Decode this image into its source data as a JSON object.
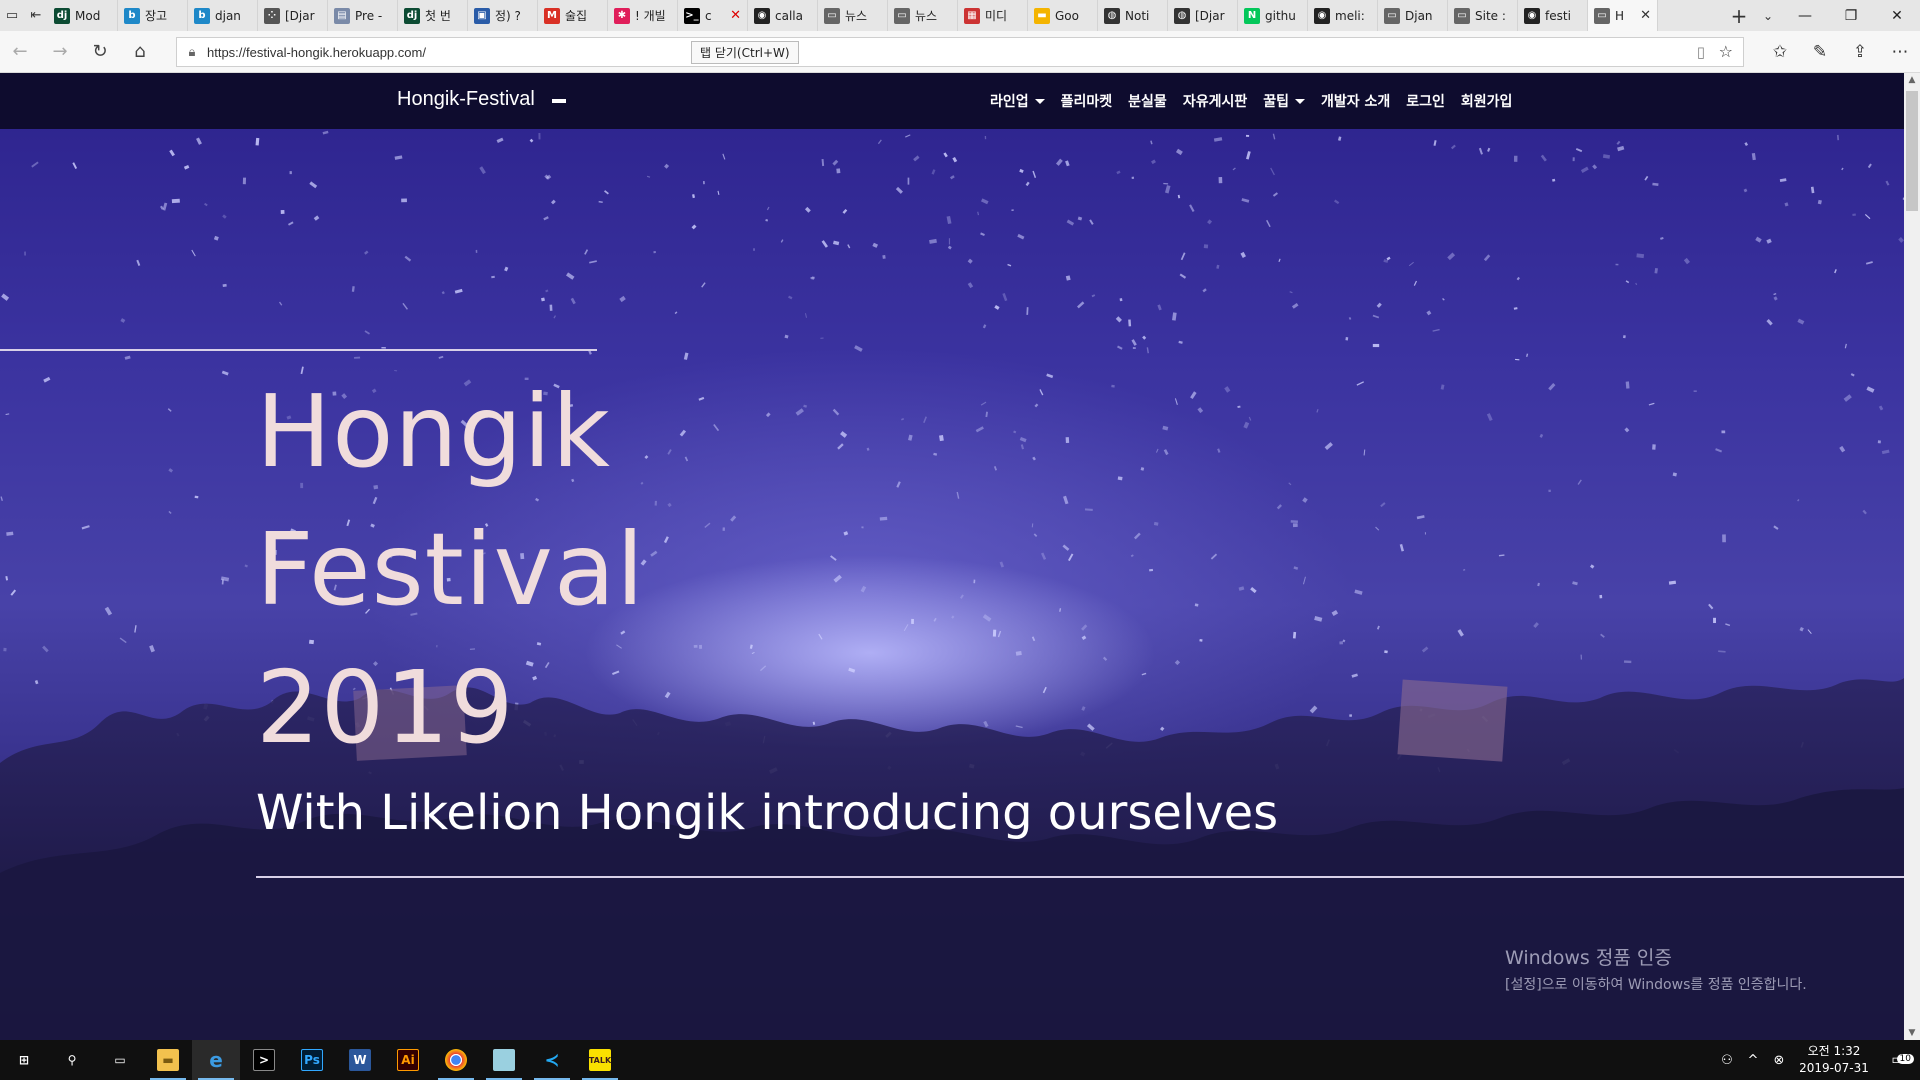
{
  "browser": {
    "tabs": [
      {
        "label": "Mod",
        "fav": "dj",
        "color": "#0c4b33",
        "icon": "django-icon"
      },
      {
        "label": "장고",
        "fav": "b",
        "color": "#1e88c8",
        "icon": "bitbucket-icon"
      },
      {
        "label": "djan",
        "fav": "b",
        "color": "#1e88c8",
        "icon": "bitbucket-icon"
      },
      {
        "label": "[Djar",
        "fav": "⁘",
        "color": "#555",
        "icon": "dots-icon"
      },
      {
        "label": "Pre -",
        "fav": "▤",
        "color": "#7a8aa8",
        "icon": "page-icon"
      },
      {
        "label": "첫 번",
        "fav": "dj",
        "color": "#0c4b33",
        "icon": "django-icon"
      },
      {
        "label": "정) ?",
        "fav": "▣",
        "color": "#2a5ca8",
        "icon": "blog-icon"
      },
      {
        "label": "술집",
        "fav": "M",
        "color": "#d93025",
        "icon": "gmail-icon"
      },
      {
        "label": "! 개빌",
        "fav": "✱",
        "color": "#e01e5a",
        "icon": "slack-icon"
      },
      {
        "label": "c",
        "fav": ">_",
        "color": "#000",
        "icon": "terminal-icon"
      },
      {
        "label": "calla",
        "fav": "◉",
        "color": "#222",
        "icon": "github-icon"
      },
      {
        "label": "뉴스",
        "fav": "▭",
        "color": "#666",
        "icon": "tab-icon"
      },
      {
        "label": "뉴스",
        "fav": "▭",
        "color": "#666",
        "icon": "tab-icon"
      },
      {
        "label": "미디",
        "fav": "▦",
        "color": "#c33",
        "icon": "media-icon"
      },
      {
        "label": "Goo",
        "fav": "▬",
        "color": "#f4b400",
        "icon": "google-slides-icon"
      },
      {
        "label": "Noti",
        "fav": "◍",
        "color": "#333",
        "icon": "notion-icon"
      },
      {
        "label": "[Djar",
        "fav": "◍",
        "color": "#333",
        "icon": "notion-icon"
      },
      {
        "label": "githu",
        "fav": "N",
        "color": "#03c75a",
        "icon": "naver-icon"
      },
      {
        "label": "meli:",
        "fav": "◉",
        "color": "#222",
        "icon": "github-icon"
      },
      {
        "label": "Djan",
        "fav": "▭",
        "color": "#666",
        "icon": "tab-icon"
      },
      {
        "label": "Site :",
        "fav": "▭",
        "color": "#666",
        "icon": "tab-icon"
      },
      {
        "label": "festi",
        "fav": "◉",
        "color": "#222",
        "icon": "github-icon"
      },
      {
        "label": "H",
        "fav": "▭",
        "color": "#666",
        "icon": "tab-icon"
      }
    ],
    "url": "https://festival-hongik.herokuapp.com/",
    "tooltip": "탭 닫기(Ctrl+W)"
  },
  "site": {
    "brand": "Hongik-Festival",
    "menu": [
      {
        "label": "라인업",
        "dropdown": true,
        "name": "nav-lineup"
      },
      {
        "label": "플리마켓",
        "dropdown": false,
        "name": "nav-flea-market"
      },
      {
        "label": "분실물",
        "dropdown": false,
        "name": "nav-lost-found"
      },
      {
        "label": "자유게시판",
        "dropdown": false,
        "name": "nav-free-board"
      },
      {
        "label": "꿀팁",
        "dropdown": true,
        "name": "nav-tips"
      },
      {
        "label": "개발자 소개",
        "dropdown": false,
        "name": "nav-developers"
      },
      {
        "label": "로그인",
        "dropdown": false,
        "name": "nav-login"
      },
      {
        "label": "회원가입",
        "dropdown": false,
        "name": "nav-signup"
      }
    ],
    "hero": {
      "line1": "Hongik",
      "line2": "Festival",
      "line3": "2019",
      "subtitle": "With Likelion Hongik introducing ourselves"
    }
  },
  "windows_activation": {
    "title": "Windows 정품 인증",
    "message": "[설정]으로 이동하여 Windows를 정품 인증합니다."
  },
  "taskbar": {
    "time": "오전 1:32",
    "date": "2019-07-31",
    "notifications": "10"
  }
}
